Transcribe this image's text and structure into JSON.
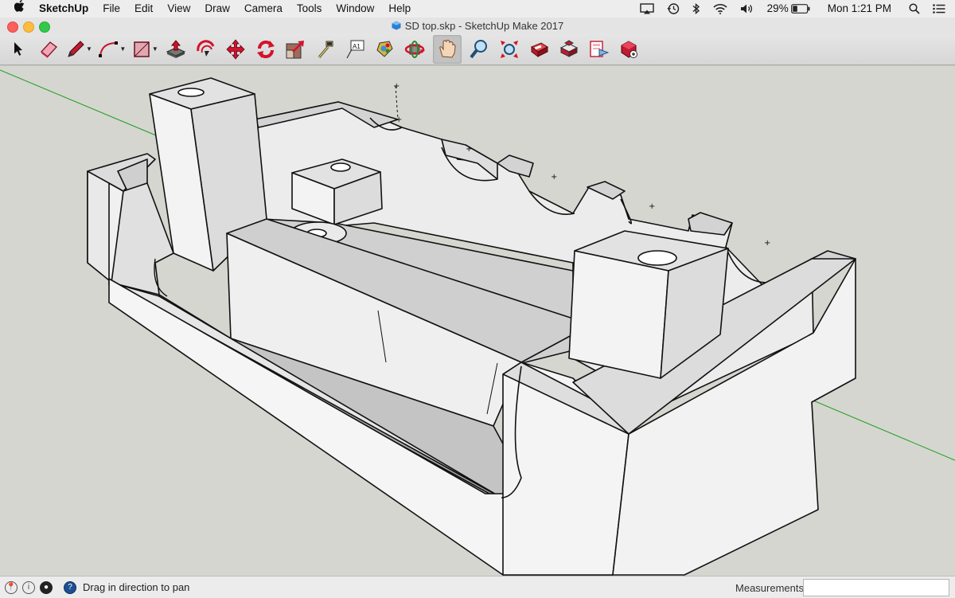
{
  "menubar": {
    "app": "SketchUp",
    "items": [
      "File",
      "Edit",
      "View",
      "Draw",
      "Camera",
      "Tools",
      "Window",
      "Help"
    ],
    "battery": "29%",
    "clock": "Mon 1:21 PM"
  },
  "window": {
    "title": "SD top.skp - SketchUp Make 2017"
  },
  "toolbar": {
    "tools": [
      "select-icon",
      "eraser-icon",
      "pencil-icon",
      "arc-icon",
      "rectangle-icon",
      "push-pull-icon",
      "offset-icon",
      "move-icon",
      "rotate-icon",
      "scale-icon",
      "tape-measure-icon",
      "text-icon",
      "paint-bucket-icon",
      "orbit-icon",
      "pan-icon",
      "zoom-icon",
      "zoom-extents-icon",
      "3d-warehouse-icon",
      "extension-warehouse-icon",
      "layout-icon",
      "extension-manager-icon"
    ],
    "active_tool": "pan-icon"
  },
  "status": {
    "hint": "Drag in direction to pan",
    "measurements_label": "Measurements",
    "measurements_value": ""
  },
  "colors": {
    "accent_red": "#d3122c",
    "axis_green": "#1a9e1a",
    "face_light": "#f2f2f2",
    "face_shadow": "#a9a9a9"
  }
}
